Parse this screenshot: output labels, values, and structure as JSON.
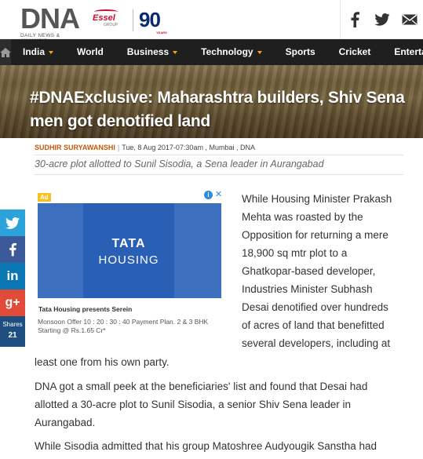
{
  "header": {
    "logo_text": "DNA",
    "logo_subtext": "DAILY NEWS & ANALYSIS",
    "partner_name": "Essel",
    "partner_group": "GROUP",
    "anniversary_number": "90",
    "anniversary_sub": "YEARS",
    "social_icons": [
      "facebook-icon",
      "twitter-icon",
      "mail-icon"
    ]
  },
  "nav": {
    "items": [
      {
        "label": "India",
        "has_dropdown": true
      },
      {
        "label": "World",
        "has_dropdown": false
      },
      {
        "label": "Business",
        "has_dropdown": true
      },
      {
        "label": "Technology",
        "has_dropdown": true
      },
      {
        "label": "Sports",
        "has_dropdown": false
      },
      {
        "label": "Cricket",
        "has_dropdown": false
      },
      {
        "label": "Entertainm",
        "has_dropdown": false
      }
    ],
    "accent": "#f7a21b"
  },
  "article": {
    "title": "#DNAExclusive: Maharashtra builders, Shiv Sena men got denotified land",
    "author": "SUDHIR SURYAWANSHI",
    "meta": "Tue, 8 Aug 2017-07:30am , Mumbai , DNA",
    "subtitle": "30-acre plot allotted to Sunil Sisodia, a Sena leader in Aurangabad",
    "p1_lines": [
      "While Housing Minister Prakash",
      "Mehta was roasted by the",
      "Opposition for returning a mere",
      "18,900 sq mtr plot to a",
      "Ghatkopar-based developer,",
      "Industries Minister Subhash",
      "Desai denotified over hundreds",
      "of acres of land that benefitted",
      "several developers, including at"
    ],
    "p1_tail": "least one from his own party.",
    "p2": "DNA got a small peek at the beneficiaries' list and found that Desai had allotted a 30-acre plot to Sunil Sisodia, a senior Shiv Sena leader in Aurangabad.",
    "p3": "While Sisodia admitted that his group Matoshree Audyougik Sanstha had"
  },
  "ad": {
    "badge": "Ad",
    "info": "i",
    "close": "✕",
    "brand_line1": "TATA",
    "brand_line2": "HOUSING",
    "headline": "Tata Housing presents Serein",
    "body": "Monsoon Offer 10 : 20 : 30 : 40 Payment Plan. 2 & 3 BHK Starting @ Rs.1.65 Cr*"
  },
  "share": {
    "label": "Shares",
    "count": "21",
    "buttons": [
      {
        "name": "twitter",
        "glyph": "t",
        "color": "#2ca2da"
      },
      {
        "name": "facebook",
        "glyph": "f",
        "color": "#3c5a99"
      },
      {
        "name": "linkedin",
        "glyph": "in",
        "color": "#0b76b4"
      },
      {
        "name": "google-plus",
        "glyph": "g+",
        "color": "#e04b3a"
      }
    ]
  }
}
